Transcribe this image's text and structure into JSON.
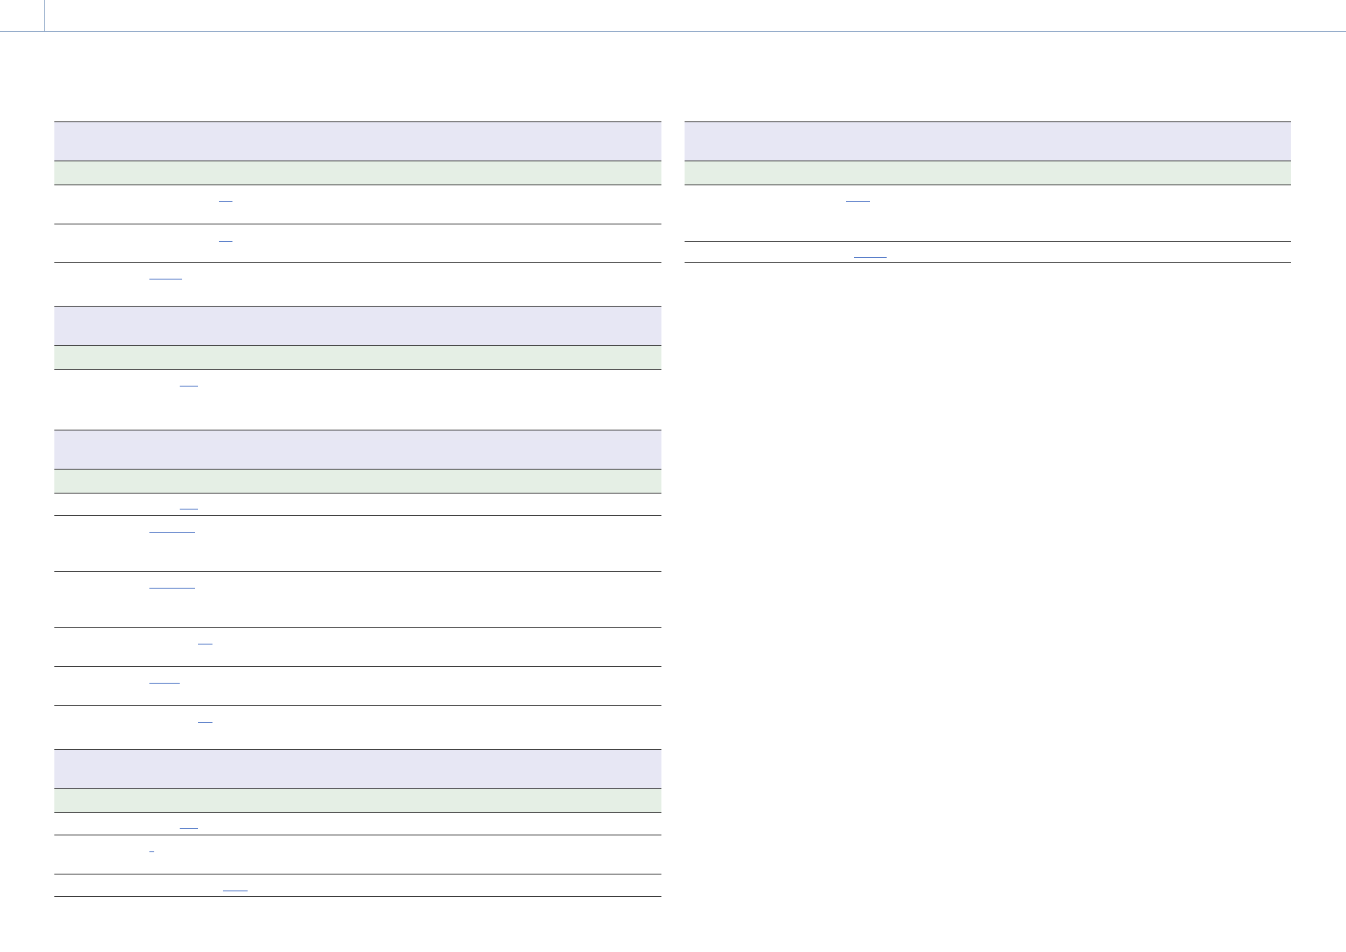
{
  "header": {
    "title": ""
  },
  "left_column": {
    "sections": [
      {
        "title": "",
        "subheading": "",
        "rows": [
          {
            "text": "",
            "link": ""
          },
          {
            "text": "",
            "link": ""
          },
          {
            "text": "",
            "link": ""
          }
        ]
      },
      {
        "title": "",
        "subheading": "",
        "rows": [
          {
            "text": "",
            "link": ""
          }
        ]
      },
      {
        "title": "",
        "subheading": "",
        "rows": [
          {
            "text": "",
            "link": ""
          },
          {
            "text": "",
            "link": ""
          },
          {
            "text": "",
            "link": ""
          },
          {
            "text": "",
            "link": ""
          },
          {
            "text": "",
            "link": ""
          },
          {
            "text": "",
            "link": ""
          }
        ]
      },
      {
        "title": "",
        "subheading": "",
        "rows": [
          {
            "text": "",
            "link": ""
          },
          {
            "text": "",
            "link": ""
          },
          {
            "text": "",
            "link": ""
          }
        ]
      }
    ]
  },
  "right_column": {
    "sections": [
      {
        "title": "",
        "subheading": "",
        "rows": [
          {
            "text": "",
            "link": ""
          },
          {
            "text": "",
            "link": ""
          }
        ]
      }
    ]
  },
  "colors": {
    "section_header_bg": "#e7e7f4",
    "section_subheader_bg": "#e5efe5",
    "link": "#4a72c4",
    "rule": "#3a3a3a",
    "header_rule": "#8fa8c8"
  }
}
